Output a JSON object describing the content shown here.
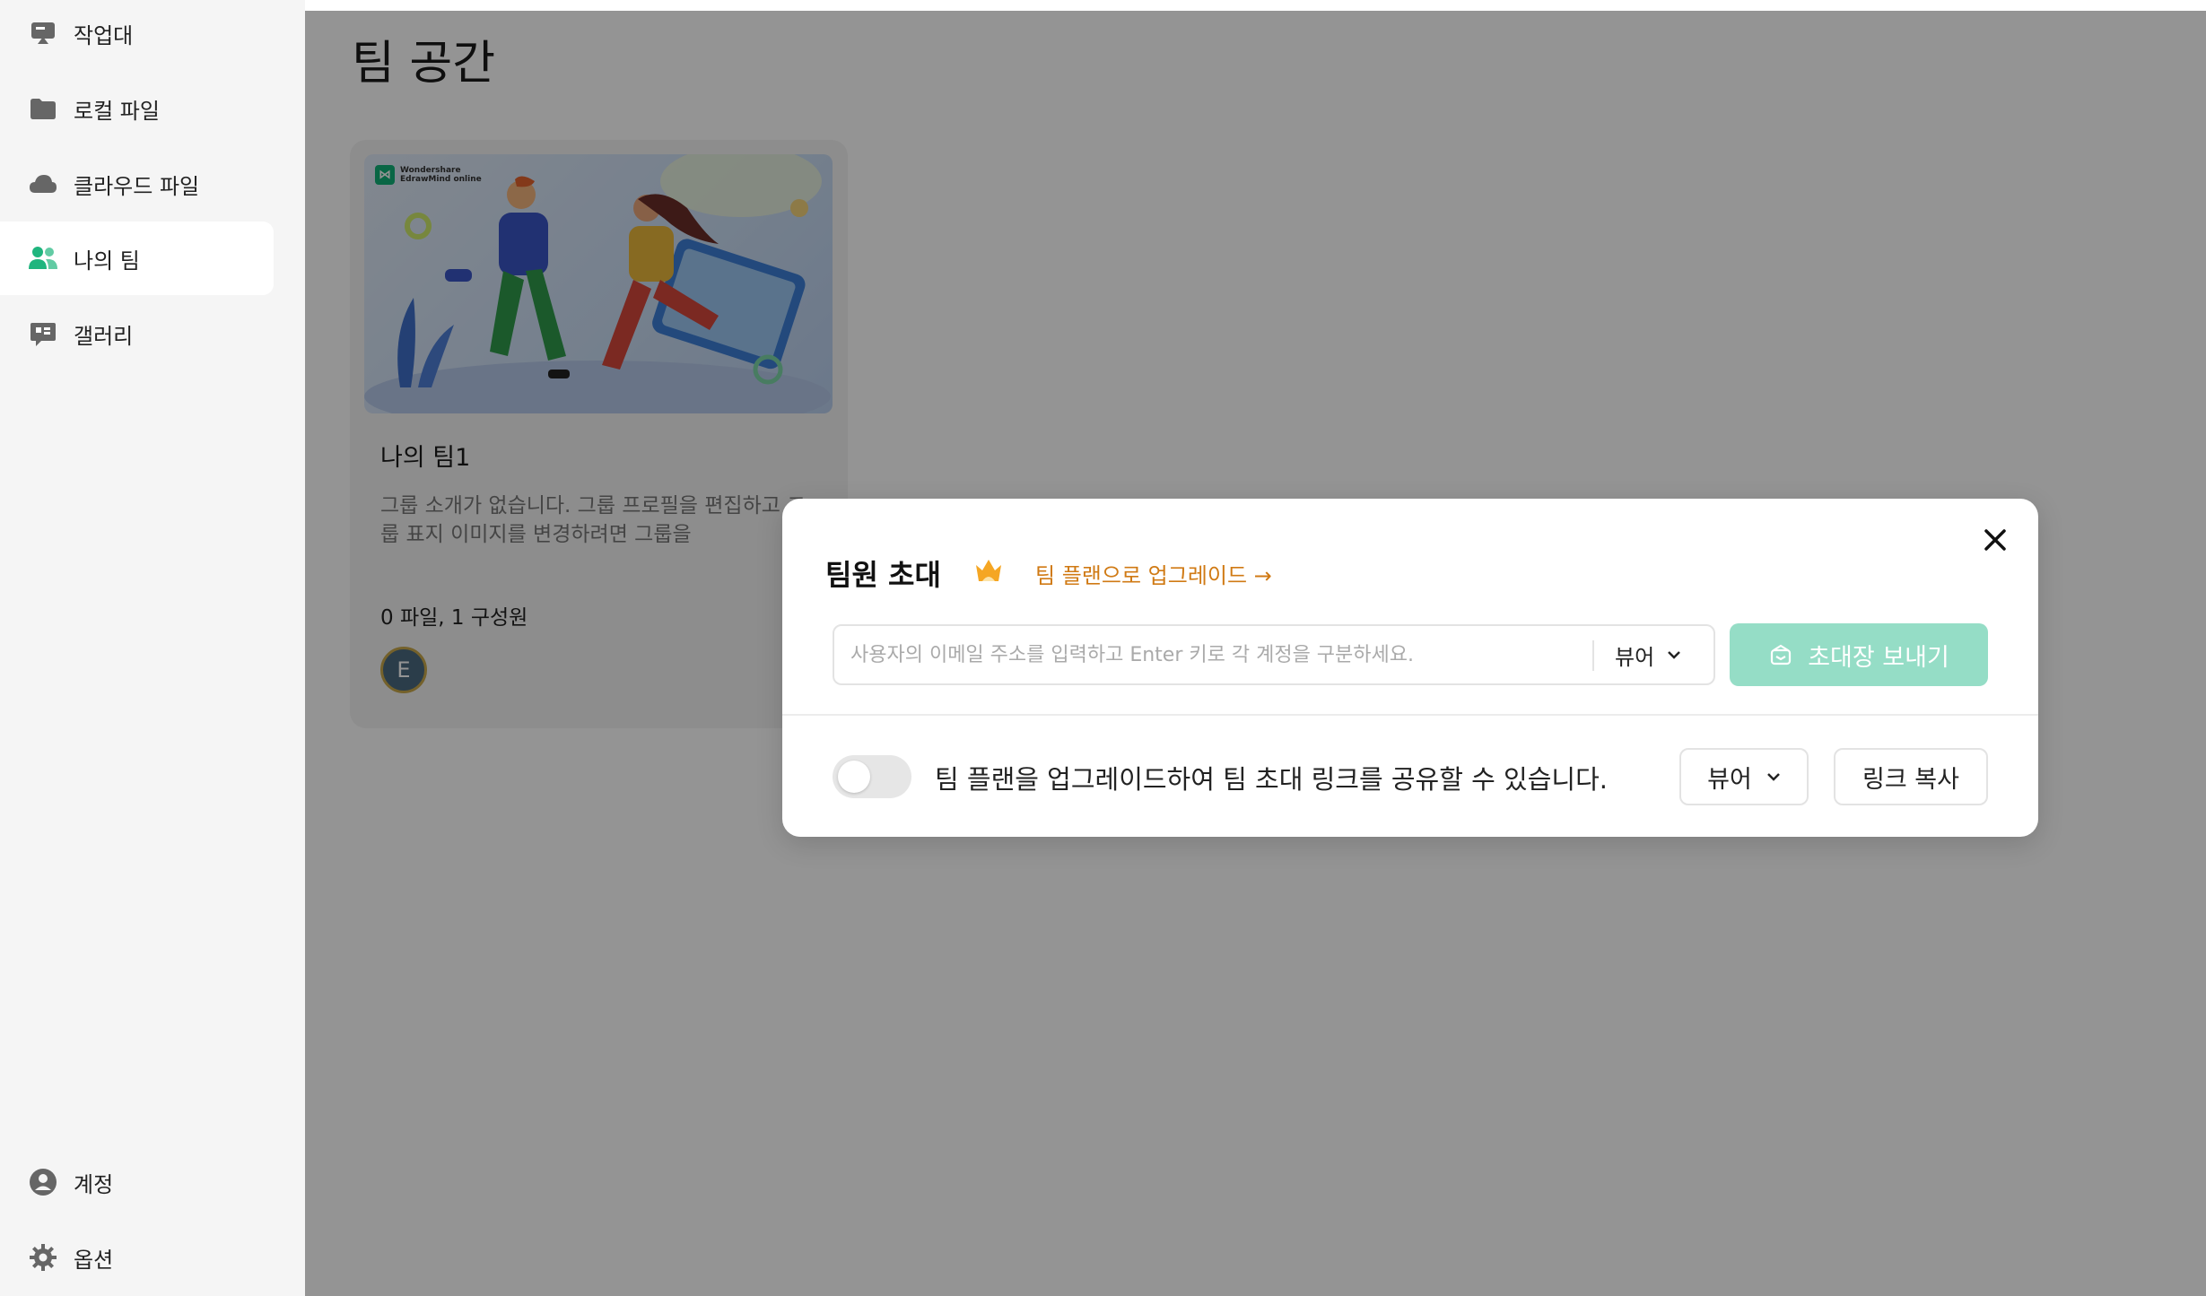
{
  "sidebar": {
    "items": [
      {
        "label": "작업대",
        "icon": "workbench-icon"
      },
      {
        "label": "로컬 파일",
        "icon": "folder-icon"
      },
      {
        "label": "클라우드 파일",
        "icon": "cloud-icon"
      },
      {
        "label": "나의 팀",
        "icon": "team-icon",
        "active": true
      },
      {
        "label": "갤러리",
        "icon": "gallery-icon"
      }
    ],
    "bottom_items": [
      {
        "label": "계정",
        "icon": "account-icon"
      },
      {
        "label": "옵션",
        "icon": "gear-icon"
      }
    ]
  },
  "main": {
    "title": "팀 공간",
    "team_card": {
      "brand_line1": "Wondershare",
      "brand_line2": "EdrawMind online",
      "name": "나의 팀1",
      "description": "그룹 소개가 없습니다. 그룹 프로필을 편집하고 그룹 표지 이미지를 변경하려면 그룹을",
      "stats": "0 파일, 1 구성원",
      "avatar_initial": "E"
    }
  },
  "modal": {
    "title": "팀원 초대",
    "upgrade_link": "팀 플랜으로 업그레이드 →",
    "email_placeholder": "사용자의 이메일 주소를 입력하고 Enter 키로 각 계정을 구분하세요.",
    "role_value": "뷰어",
    "send_button": "초대장 보내기",
    "share_text": "팀 플랜을 업그레이드하여 팀 초대 링크를 공유할 수 있습니다.",
    "share_role_value": "뷰어",
    "copy_link_button": "링크 복사",
    "toggle_on": false
  },
  "colors": {
    "accent_green": "#95ddc6",
    "upgrade_orange": "#d07a14",
    "team_icon_green": "#1fb57e"
  }
}
